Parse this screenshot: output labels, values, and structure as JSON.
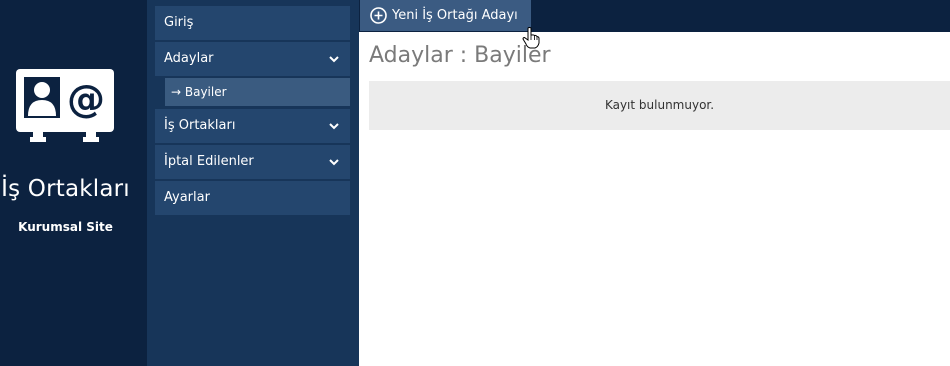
{
  "brand": {
    "title": "İş Ortakları",
    "subtitle": "Kurumsal Site",
    "logo_icon": "contact-card-icon"
  },
  "sidebar": {
    "items": [
      {
        "label": "Giriş"
      },
      {
        "label": "Adaylar",
        "has_chevron": true
      },
      {
        "label": "→ Bayiler",
        "sub": true,
        "active": true
      },
      {
        "label": "İş Ortakları",
        "has_chevron": true
      },
      {
        "label": "İptal Edilenler",
        "has_chevron": true
      },
      {
        "label": "Ayarlar"
      }
    ]
  },
  "toolbar": {
    "add_button_label": "Yeni İş Ortağı Adayı Ekle",
    "add_button_icon": "plus-circle-icon"
  },
  "main": {
    "page_title": "Adaylar : Bayiler",
    "empty_message": "Kayıt bulunmuyor."
  },
  "colors": {
    "brand_bg": "#0c2240",
    "sidebar_bg": "#173559",
    "nav_item_bg": "#24466e",
    "nav_sub_bg": "#3a5b80",
    "button_bg": "#3b5b82"
  }
}
